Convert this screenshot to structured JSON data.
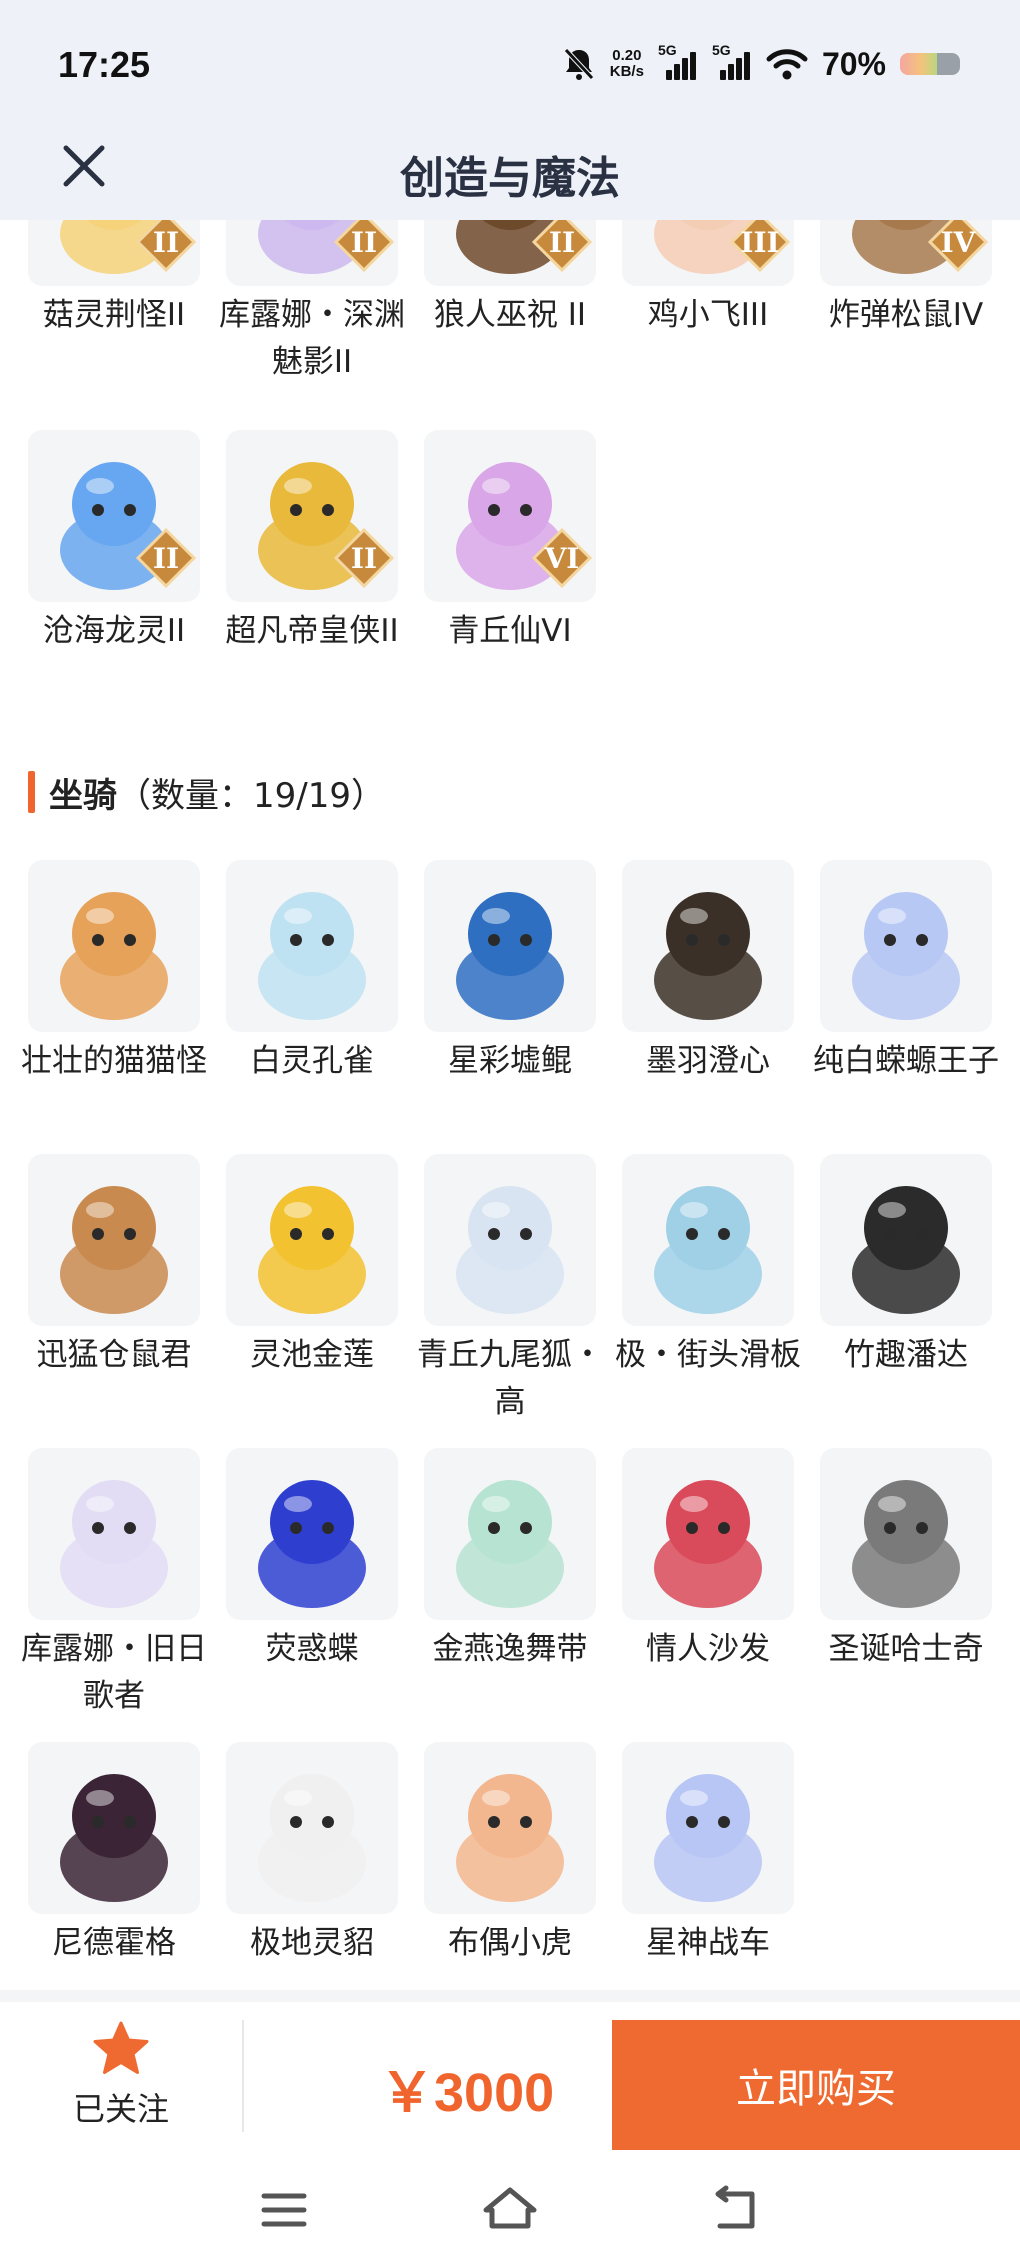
{
  "status": {
    "time": "17:25",
    "net_speed_value": "0.20",
    "net_speed_unit": "KB/s",
    "signal_1": "5G",
    "signal_2": "5G",
    "battery": "70%"
  },
  "header": {
    "title": "创造与魔法"
  },
  "partial_row": [
    {
      "name": "菇灵荆怪II",
      "badge": "II",
      "icon": "mushroom-sprite-icon",
      "color": "#f6d27a"
    },
    {
      "name": "库露娜・深渊魅影II",
      "badge": "II",
      "icon": "kuluna-abyss-icon",
      "color": "#cdb8ef"
    },
    {
      "name": "狼人巫祝 II",
      "badge": "II",
      "icon": "werewolf-shaman-icon",
      "color": "#6e4a2c"
    },
    {
      "name": "鸡小飞III",
      "badge": "III",
      "icon": "chick-icon",
      "color": "#f4cdb5"
    },
    {
      "name": "炸弹松鼠IV",
      "badge": "IV",
      "icon": "bomb-squirrel-icon",
      "color": "#a77a4e"
    }
  ],
  "pets_row2": [
    {
      "name": "沧海龙灵II",
      "badge": "II",
      "icon": "sea-dragon-spirit-icon",
      "color": "#67a6f0"
    },
    {
      "name": "超凡帝皇侠II",
      "badge": "II",
      "icon": "emperor-knight-icon",
      "color": "#e8b93a"
    },
    {
      "name": "青丘仙VI",
      "badge": "VI",
      "icon": "qingqiu-fairy-icon",
      "color": "#d9a6e8"
    }
  ],
  "mounts": {
    "title": "坐骑",
    "count": "（数量：19/19）",
    "items": [
      {
        "name": "壮壮的猫猫怪",
        "icon": "chubby-cat-icon",
        "color": "#e7a25a"
      },
      {
        "name": "白灵孔雀",
        "icon": "white-peacock-icon",
        "color": "#bfe2f2"
      },
      {
        "name": "星彩墟鲲",
        "icon": "starry-whale-icon",
        "color": "#2f6fc2"
      },
      {
        "name": "墨羽澄心",
        "icon": "ink-feather-icon",
        "color": "#3b3027"
      },
      {
        "name": "纯白蝾螈王子",
        "icon": "axolotl-prince-icon",
        "color": "#b8c8f4"
      },
      {
        "name": "迅猛仓鼠君",
        "icon": "hamster-pilot-icon",
        "color": "#c88a4e"
      },
      {
        "name": "灵池金莲",
        "icon": "golden-lotus-icon",
        "color": "#f2c230"
      },
      {
        "name": "青丘九尾狐・高",
        "icon": "nine-tail-fox-icon",
        "color": "#d8e4f2"
      },
      {
        "name": "极・街头滑板",
        "icon": "skateboard-icon",
        "color": "#9fd0e6"
      },
      {
        "name": "竹趣潘达",
        "icon": "panda-icon",
        "color": "#2b2b2b"
      },
      {
        "name": "库露娜・旧日歌者",
        "icon": "kuluna-singer-icon",
        "color": "#e2dcf4"
      },
      {
        "name": "荧惑蝶",
        "icon": "blue-butterfly-icon",
        "color": "#2e3fd0"
      },
      {
        "name": "金燕逸舞带",
        "icon": "swallow-ribbon-icon",
        "color": "#b7e3d2"
      },
      {
        "name": "情人沙发",
        "icon": "lover-sofa-icon",
        "color": "#d94a5a"
      },
      {
        "name": "圣诞哈士奇",
        "icon": "christmas-husky-icon",
        "color": "#7a7a7a"
      },
      {
        "name": "尼德霍格",
        "icon": "nidhogg-dragon-icon",
        "color": "#3a2436"
      },
      {
        "name": "极地灵貂",
        "icon": "polar-mink-icon",
        "color": "#f0f0f0"
      },
      {
        "name": "布偶小虎",
        "icon": "cloth-tiger-icon",
        "color": "#f3b78f"
      },
      {
        "name": "星神战车",
        "icon": "star-chariot-icon",
        "color": "#b8c6f6"
      }
    ]
  },
  "action_bar": {
    "follow_label": "已关注",
    "price": "￥3000",
    "buy_label": "立即购买"
  },
  "colors": {
    "accent": "#ee6a30",
    "header_bg": "#eef2f8",
    "thumb_bg": "#f4f5f7"
  }
}
